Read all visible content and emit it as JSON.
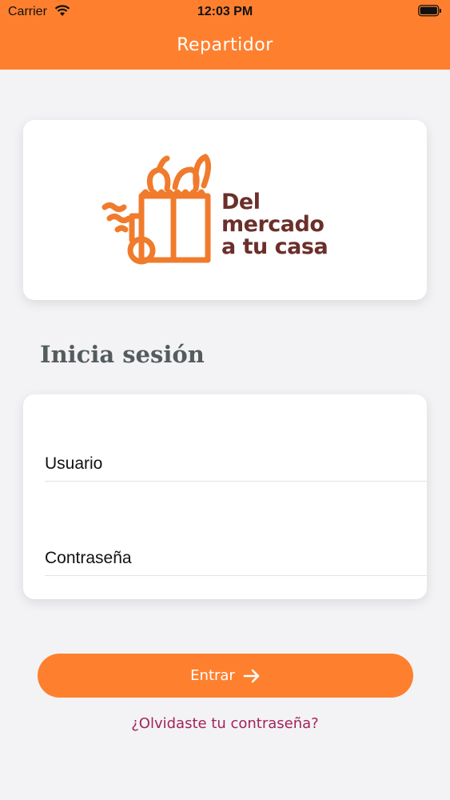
{
  "status_bar": {
    "carrier": "Carrier",
    "time": "12:03 PM",
    "wifi_icon": "wifi-icon",
    "battery_icon": "battery-icon"
  },
  "header": {
    "title": "Repartidor",
    "background_color": "#fe802f"
  },
  "logo": {
    "line1": "Del",
    "line2": "mercado",
    "line3": "a tu casa",
    "icon": "grocery-bag-cart-icon",
    "accent_color": "#f07b2c",
    "text_color": "#6b2f2a"
  },
  "login": {
    "title": "Inicia sesión",
    "username_placeholder": "Usuario",
    "password_placeholder": "Contraseña",
    "submit_label": "Entrar",
    "submit_icon": "arrow-right-icon",
    "forgot_password": "¿Olvidaste tu contraseña?",
    "link_color": "#a3225c"
  }
}
